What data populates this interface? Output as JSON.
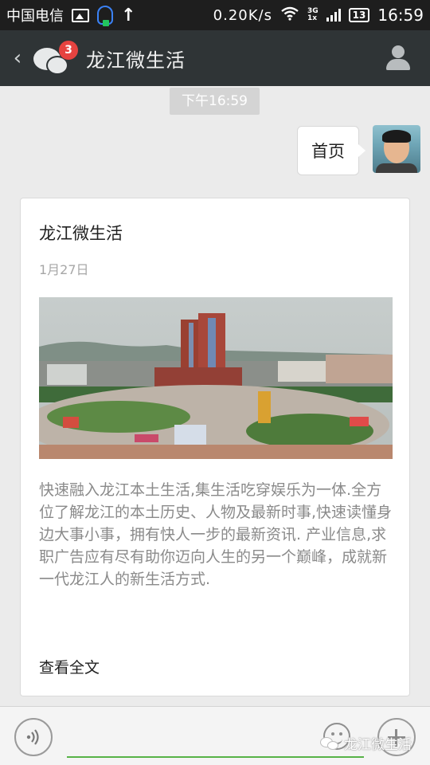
{
  "status_bar": {
    "carrier": "中国电信",
    "network_speed": "0.20K/s",
    "net_top": "3G",
    "net_bottom": "1x",
    "battery": "13",
    "time": "16:59",
    "icons": [
      "image-icon",
      "qq-icon",
      "upload-arrow-icon",
      "wifi-icon",
      "signal-icon",
      "battery-icon"
    ]
  },
  "header": {
    "title": "龙江微生活",
    "badge_count": "3",
    "back_icon": "back-chevron-icon",
    "chat_icon": "wechat-chat-icon",
    "profile_icon": "profile-icon"
  },
  "conversation": {
    "time_label": "下午16:59",
    "sent_message": "首页"
  },
  "article_card": {
    "title": "龙江微生活",
    "date": "1月27日",
    "description": "快速融入龙江本土生活,集生活吃穿娱乐为一体.全方位了解龙江的本土历史、人物及最新时事,快速读懂身边大事小事，拥有快人一步的最新资讯. 产业信息,求职广告应有尽有助你迈向人生的另一个巅峰，成就新一代龙江人的新生活方式.",
    "read_more": "查看全文"
  },
  "input_bar": {
    "voice_icon": "voice-icon",
    "emoji_icon": "emoji-icon",
    "plus_icon": "plus-icon",
    "input_value": ""
  },
  "watermark": {
    "text": "龙江微生活"
  },
  "colors": {
    "title_bar": "#2f3436",
    "status_bar": "#1e1e1e",
    "background": "#ebebeb",
    "badge": "#e64340",
    "input_underline": "#57b347"
  }
}
